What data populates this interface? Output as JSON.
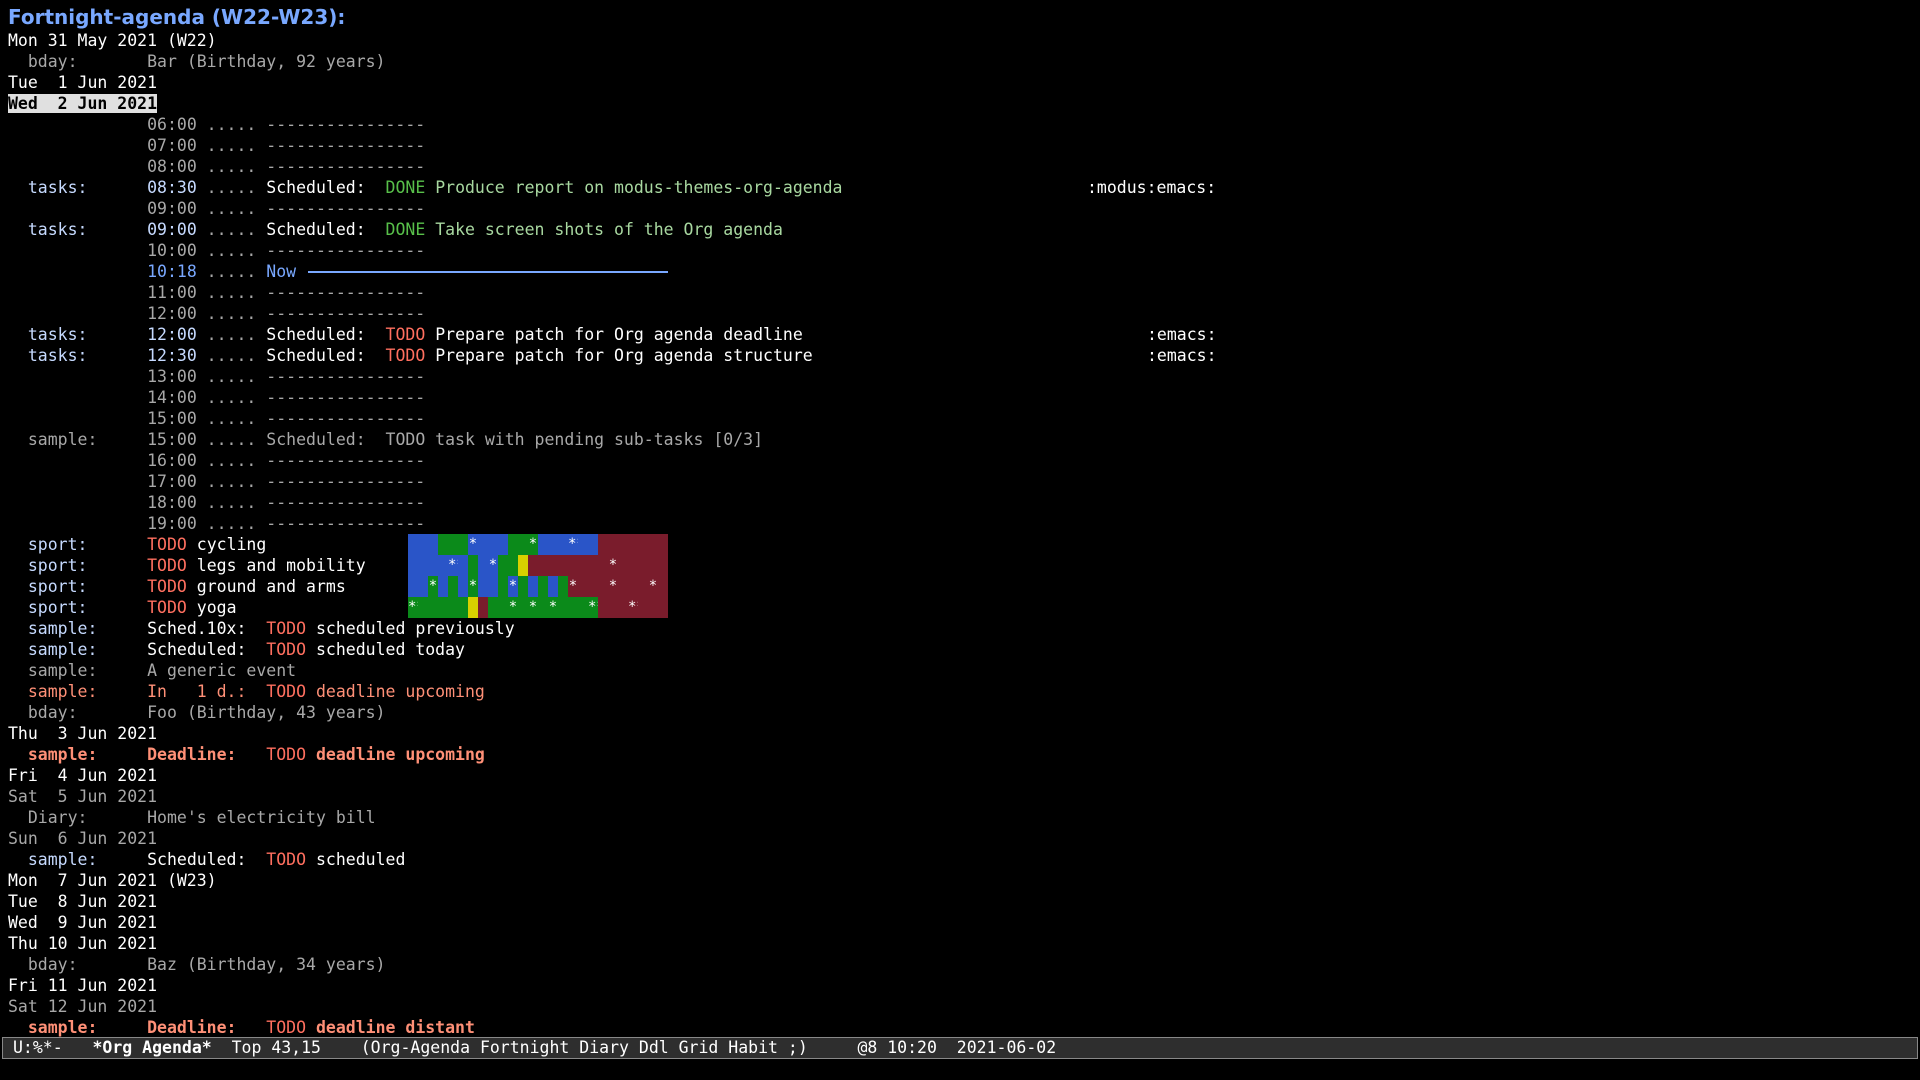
{
  "title": "Fortnight-agenda (W22-W23):",
  "lines": [
    {
      "kind": "date",
      "text": "Mon 31 May 2021 (W22)"
    },
    {
      "kind": "entry",
      "cat": "  bday:",
      "body": "Bar (Birthday, 92 years)",
      "style": "dim"
    },
    {
      "kind": "date",
      "text": "Tue  1 Jun 2021"
    },
    {
      "kind": "today",
      "text": "Wed  2 Jun 2021"
    },
    {
      "kind": "grid",
      "time": "06:00",
      "dots": ".....",
      "rule": "----------------"
    },
    {
      "kind": "grid",
      "time": "07:00",
      "dots": ".....",
      "rule": "----------------"
    },
    {
      "kind": "grid",
      "time": "08:00",
      "dots": ".....",
      "rule": "----------------"
    },
    {
      "kind": "task",
      "cat": "  tasks:",
      "time": "08:30",
      "dots": ".....",
      "sched": "Scheduled:",
      "state": "DONE",
      "text": "Produce report on modus-themes-org-agenda",
      "tag": ":modus:emacs:",
      "tag_col": "1079"
    },
    {
      "kind": "grid",
      "time": "09:00",
      "dots": ".....",
      "rule": "----------------"
    },
    {
      "kind": "task",
      "cat": "  tasks:",
      "time": "09:00",
      "dots": ".....",
      "sched": "Scheduled:",
      "state": "DONE",
      "text": "Take screen shots of the Org agenda",
      "tag": ""
    },
    {
      "kind": "grid",
      "time": "10:00",
      "dots": ".....",
      "rule": "----------------"
    },
    {
      "kind": "now",
      "time": "10:18",
      "dots": ".....",
      "text": "Now"
    },
    {
      "kind": "grid",
      "time": "11:00",
      "dots": ".....",
      "rule": "----------------"
    },
    {
      "kind": "grid",
      "time": "12:00",
      "dots": ".....",
      "rule": "----------------"
    },
    {
      "kind": "task",
      "cat": "  tasks:",
      "time": "12:00",
      "dots": ".....",
      "sched": "Scheduled:",
      "state": "TODO",
      "text": "Prepare patch for Org agenda deadline",
      "tag": ":emacs:",
      "tag_col": "1139"
    },
    {
      "kind": "task",
      "cat": "  tasks:",
      "time": "12:30",
      "dots": ".....",
      "sched": "Scheduled:",
      "state": "TODO",
      "text": "Prepare patch for Org agenda structure",
      "tag": ":emacs:",
      "tag_col": "1139"
    },
    {
      "kind": "grid",
      "time": "13:00",
      "dots": ".....",
      "rule": "----------------"
    },
    {
      "kind": "grid",
      "time": "14:00",
      "dots": ".....",
      "rule": "----------------"
    },
    {
      "kind": "grid",
      "time": "15:00",
      "dots": ".....",
      "rule": "----------------"
    },
    {
      "kind": "sample",
      "cat": "  sample:",
      "time": "15:00",
      "dots": ".....",
      "sched": "Scheduled:",
      "text": "TODO task with pending sub-tasks [0/3]"
    },
    {
      "kind": "grid",
      "time": "16:00",
      "dots": ".....",
      "rule": "----------------"
    },
    {
      "kind": "grid",
      "time": "17:00",
      "dots": ".....",
      "rule": "----------------"
    },
    {
      "kind": "grid",
      "time": "18:00",
      "dots": ".....",
      "rule": "----------------"
    },
    {
      "kind": "grid",
      "time": "19:00",
      "dots": ".....",
      "rule": "----------------"
    },
    {
      "kind": "habit",
      "cat": "  sport:",
      "state": "TODO",
      "text": "cycling",
      "cells": "bbbgggbbbbgggbbbbbbrrrrrrr",
      "stars": [
        [
          "3",
          "*"
        ],
        [
          "6",
          "*"
        ],
        [
          "8",
          "**"
        ],
        [
          "13",
          "!"
        ]
      ]
    },
    {
      "kind": "habit",
      "cat": "  sport:",
      "state": "TODO",
      "text": "legs and mobility",
      "cells": "bbbbbbgbbggyrrrrrrrrrrrrrr",
      "stars": [
        [
          "2",
          "***"
        ],
        [
          "4",
          "*"
        ],
        [
          "10",
          "*"
        ],
        [
          "13",
          "!"
        ]
      ]
    },
    {
      "kind": "habit",
      "cat": "  sport:",
      "state": "TODO",
      "text": "ground and arms",
      "cells": "bbgbgbgbbgbgbgbgrrrrrrrrrr",
      "stars": [
        [
          "1",
          "*"
        ],
        [
          "3",
          "*"
        ],
        [
          "5",
          "*"
        ],
        [
          "8",
          "*"
        ],
        [
          "10",
          "*"
        ],
        [
          "12",
          "*"
        ],
        [
          "13",
          "!"
        ]
      ]
    },
    {
      "kind": "habit",
      "cat": "  sport:",
      "state": "TODO",
      "text": "yoga",
      "cells": "ggggggyrgggggggggggrrrrrrr",
      "stars": [
        [
          "0",
          "***"
        ],
        [
          "5",
          "*"
        ],
        [
          "6",
          "*"
        ],
        [
          "7",
          "*"
        ],
        [
          "9",
          "***"
        ],
        [
          "11",
          "***"
        ],
        [
          "13",
          "!"
        ]
      ]
    },
    {
      "kind": "plain",
      "cat": "  sample:",
      "pre": "Sched.10x:",
      "state": "TODO",
      "text": "scheduled previously"
    },
    {
      "kind": "plain",
      "cat": "  sample:",
      "pre": "Scheduled:",
      "state": "TODO",
      "text": "scheduled today"
    },
    {
      "kind": "entry",
      "cat": "  sample:",
      "body": "A generic event",
      "style": "dim"
    },
    {
      "kind": "upcoming",
      "cat": "  sample:",
      "pre": "In   1 d.:",
      "state": "TODO",
      "text": "deadline upcoming"
    },
    {
      "kind": "entry",
      "cat": "  bday:",
      "body": "Foo (Birthday, 43 years)",
      "style": "dim"
    },
    {
      "kind": "date",
      "text": "Thu  3 Jun 2021"
    },
    {
      "kind": "deadline",
      "cat": "  sample:",
      "pre": "Deadline:",
      "state": "TODO",
      "text": "deadline upcoming"
    },
    {
      "kind": "date",
      "text": "Fri  4 Jun 2021"
    },
    {
      "kind": "weekend",
      "text": "Sat  5 Jun 2021"
    },
    {
      "kind": "entry",
      "cat": "  Diary:",
      "body": "Home's electricity bill",
      "style": "dim"
    },
    {
      "kind": "weekend",
      "text": "Sun  6 Jun 2021"
    },
    {
      "kind": "plain",
      "cat": "  sample:",
      "pre": "Scheduled:",
      "state": "TODO",
      "text": "scheduled"
    },
    {
      "kind": "date",
      "text": "Mon  7 Jun 2021 (W23)"
    },
    {
      "kind": "date",
      "text": "Tue  8 Jun 2021"
    },
    {
      "kind": "date",
      "text": "Wed  9 Jun 2021"
    },
    {
      "kind": "date",
      "text": "Thu 10 Jun 2021"
    },
    {
      "kind": "entry",
      "cat": "  bday:",
      "body": "Baz (Birthday, 34 years)",
      "style": "dim"
    },
    {
      "kind": "date",
      "text": "Fri 11 Jun 2021"
    },
    {
      "kind": "weekend",
      "text": "Sat 12 Jun 2021"
    },
    {
      "kind": "deadline",
      "cat": "  sample:",
      "pre": "Deadline:",
      "state": "TODO",
      "text": "deadline distant"
    }
  ],
  "modeline": {
    "state": "U:%*-",
    "buffer": "*Org Agenda*",
    "position": "Top 43,15",
    "modes": "(Org-Agenda Fortnight Diary Ddl Grid Habit ;)",
    "extra": "@8 10:20",
    "date": "2021-06-02"
  },
  "colors": {
    "background": "#000000",
    "title": "#79a8ff",
    "done": "#58c04a",
    "todo": "#ff6f5f",
    "now": "#79a8ff",
    "habit_blue": "#2a55c8",
    "habit_green": "#0b8a1a",
    "habit_yellow": "#d8d000",
    "habit_red": "#7a1c2c"
  }
}
